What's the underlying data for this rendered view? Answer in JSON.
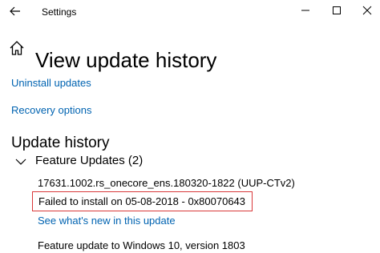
{
  "window": {
    "title": "Settings",
    "accent_color": "#0063b1",
    "highlight_color": "#d9383a"
  },
  "icons": {
    "back": "arrow-left-icon",
    "home": "home-icon",
    "minimize": "minimize-icon",
    "maximize": "maximize-icon",
    "close": "close-icon",
    "chevron": "chevron-down-icon"
  },
  "header": {
    "title": "View update history"
  },
  "links": {
    "uninstall": "Uninstall updates",
    "recovery": "Recovery options"
  },
  "history": {
    "heading": "Update history",
    "group": {
      "label": "Feature Updates (2)",
      "expanded": true,
      "items": [
        {
          "name": "17631.1002.rs_onecore_ens.180320-1822 (UUP-CTv2)",
          "status": "Failed to install on 05-08-2018 - 0x80070643",
          "link": "See what's new in this update"
        },
        {
          "name": "Feature update to Windows 10, version 1803"
        }
      ]
    }
  }
}
